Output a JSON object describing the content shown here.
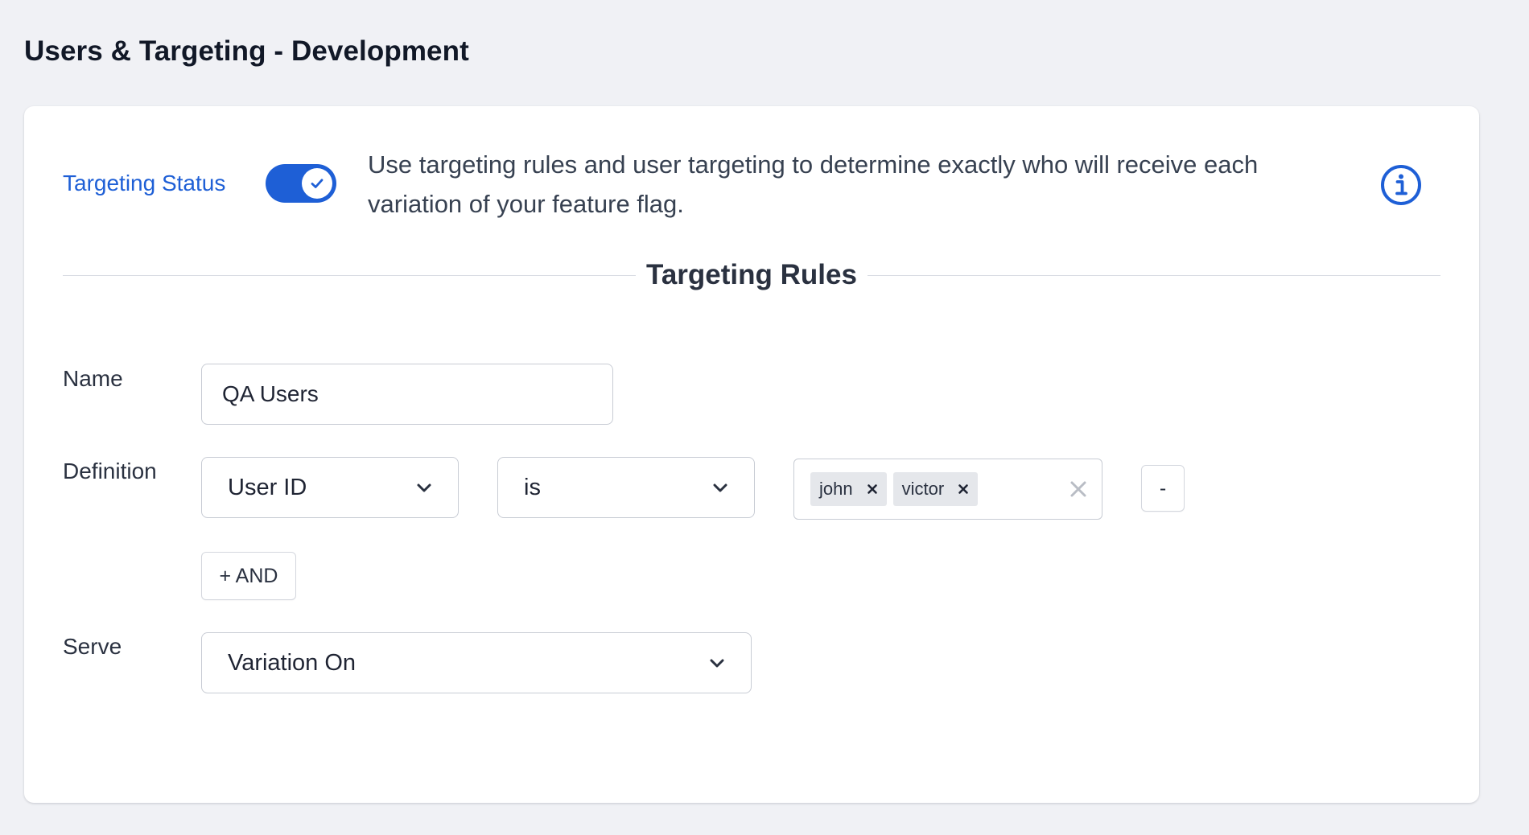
{
  "page": {
    "title": "Users & Targeting - Development"
  },
  "targeting_status": {
    "label": "Targeting Status",
    "enabled": true,
    "description": "Use targeting rules and user targeting to determine exactly who will receive each variation of your feature flag.",
    "accent_color": "#1e5fd6"
  },
  "targeting_rules": {
    "title": "Targeting Rules",
    "name_label": "Name",
    "name_value": "QA Users",
    "definition_label": "Definition",
    "definition": {
      "property": "User ID",
      "operator": "is",
      "values": [
        "john",
        "victor"
      ],
      "remove_label": "-"
    },
    "and_button_label": "+ AND",
    "serve_label": "Serve",
    "serve_value": "Variation On"
  },
  "icons": {
    "toggle_check": "check-icon",
    "info": "info-circle-icon",
    "dropdown": "chevron-down-icon",
    "tag_remove": "x-icon",
    "clear_all": "x-icon"
  }
}
